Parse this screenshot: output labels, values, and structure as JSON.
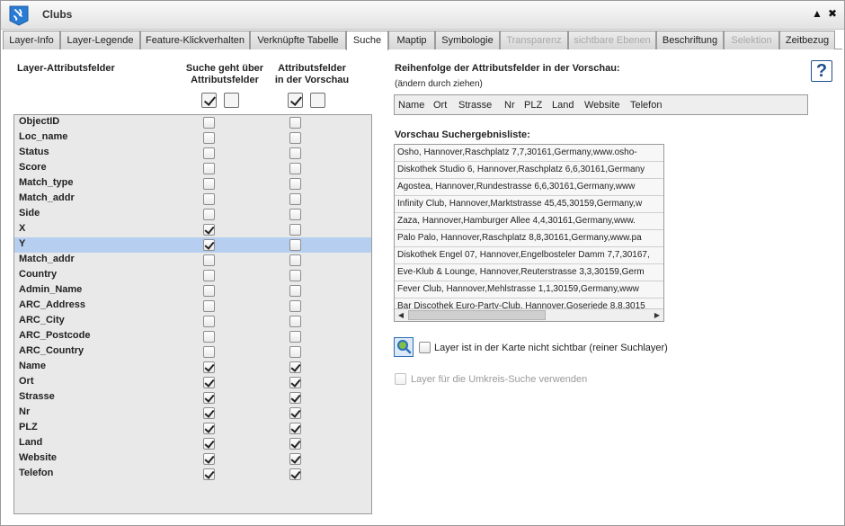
{
  "window": {
    "title": "Clubs",
    "collapse_glyph": "▲",
    "close_glyph": "✖"
  },
  "tabs": [
    {
      "label": "Layer-Info",
      "state": "normal"
    },
    {
      "label": "Layer-Legende",
      "state": "normal"
    },
    {
      "label": "Feature-Klickverhalten",
      "state": "normal"
    },
    {
      "label": "Verknüpfte Tabelle",
      "state": "normal"
    },
    {
      "label": "Suche",
      "state": "active"
    },
    {
      "label": "Maptip",
      "state": "normal"
    },
    {
      "label": "Symbologie",
      "state": "normal"
    },
    {
      "label": "Transparenz",
      "state": "disabled"
    },
    {
      "label": "sichtbare Ebenen",
      "state": "disabled"
    },
    {
      "label": "Beschriftung",
      "state": "normal"
    },
    {
      "label": "Selektion",
      "state": "disabled"
    },
    {
      "label": "Zeitbezug",
      "state": "normal"
    }
  ],
  "left": {
    "col_fields_header": "Layer-Attributsfelder",
    "col_search_header": "Suche geht über\nAttributsfelder",
    "col_preview_header": "Attributsfelder\nin der Vorschau",
    "select_all": {
      "search": [
        true,
        false
      ],
      "preview": [
        true,
        false
      ]
    },
    "fields": [
      {
        "name": "ObjectID",
        "search": false,
        "preview": false
      },
      {
        "name": "Loc_name",
        "search": false,
        "preview": false
      },
      {
        "name": "Status",
        "search": false,
        "preview": false
      },
      {
        "name": "Score",
        "search": false,
        "preview": false
      },
      {
        "name": "Match_type",
        "search": false,
        "preview": false
      },
      {
        "name": "Match_addr",
        "search": false,
        "preview": false
      },
      {
        "name": "Side",
        "search": false,
        "preview": false
      },
      {
        "name": "X",
        "search": true,
        "preview": false
      },
      {
        "name": "Y",
        "search": true,
        "preview": false,
        "selected": true
      },
      {
        "name": "Match_addr",
        "search": false,
        "preview": false
      },
      {
        "name": "Country",
        "search": false,
        "preview": false
      },
      {
        "name": "Admin_Name",
        "search": false,
        "preview": false
      },
      {
        "name": "ARC_Address",
        "search": false,
        "preview": false
      },
      {
        "name": "ARC_City",
        "search": false,
        "preview": false
      },
      {
        "name": "ARC_Postcode",
        "search": false,
        "preview": false
      },
      {
        "name": "ARC_Country",
        "search": false,
        "preview": false
      },
      {
        "name": "Name",
        "search": true,
        "preview": true
      },
      {
        "name": "Ort",
        "search": true,
        "preview": true
      },
      {
        "name": "Strasse",
        "search": true,
        "preview": true
      },
      {
        "name": "Nr",
        "search": true,
        "preview": true
      },
      {
        "name": "PLZ",
        "search": true,
        "preview": true
      },
      {
        "name": "Land",
        "search": true,
        "preview": true
      },
      {
        "name": "Website",
        "search": true,
        "preview": true
      },
      {
        "name": "Telefon",
        "search": true,
        "preview": true
      }
    ]
  },
  "right": {
    "order_title": "Reihenfolge der Attributsfelder in der Vorschau:",
    "order_hint": "(ändern durch ziehen)",
    "order_fields": [
      "Name",
      "Ort",
      "Strasse",
      "Nr",
      "PLZ",
      "Land",
      "Website",
      "Telefon"
    ],
    "preview_title": "Vorschau Suchergebnisliste:",
    "preview_rows": [
      "Osho, Hannover,Raschplatz 7,7,30161,Germany,www.osho-",
      "Diskothek Studio 6, Hannover,Raschplatz 6,6,30161,Germany",
      "Agostea, Hannover,Rundestrasse 6,6,30161,Germany,www",
      "Infinity Club, Hannover,Marktstrasse 45,45,30159,Germany,w",
      "Zaza, Hannover,Hamburger Allee 4,4,30161,Germany,www.",
      "Palo Palo, Hannover,Raschplatz 8,8,30161,Germany,www.pa",
      "Diskothek Engel 07, Hannover,Engelbosteler Damm 7,7,30167,",
      "Eve-Klub & Lounge, Hannover,Reuterstrasse 3,3,30159,Germ",
      "Fever Club, Hannover,Mehlstrasse 1,1,30159,Germany,www",
      "Bar Discothek Euro-Party-Club, Hannover,Goseriede 8,8,3015"
    ],
    "hidden_layer_label": "Layer ist in der Karte nicht sichtbar (reiner Suchlayer)",
    "hidden_layer_checked": false,
    "radius_label": "Layer für die Umkreis-Suche verwenden",
    "radius_checked": false,
    "help_label": "?"
  }
}
